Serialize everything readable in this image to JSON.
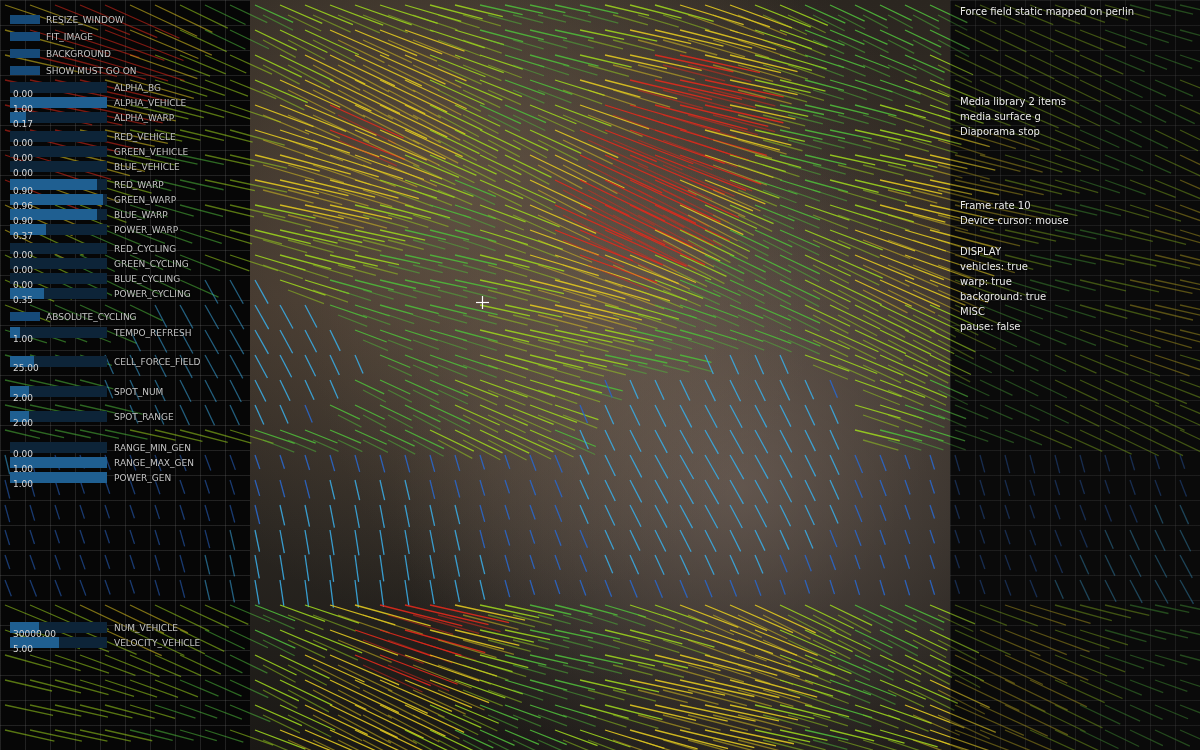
{
  "control_groups": [
    [
      {
        "kind": "button",
        "label": "RESIZE_WINDOW"
      },
      {
        "kind": "button",
        "label": "FIT_IMAGE"
      },
      {
        "kind": "button",
        "label": "BACKGROUND"
      },
      {
        "kind": "button",
        "label": "SHOW MUST GO ON"
      }
    ],
    [
      {
        "kind": "slider",
        "label": "ALPHA_BG",
        "value": "0.00",
        "level": 0.0
      },
      {
        "kind": "slider",
        "label": "ALPHA_VEHICLE",
        "value": "1.00",
        "level": 1.0
      },
      {
        "kind": "slider",
        "label": "ALPHA_WARP",
        "value": "0.17",
        "level": 0.17
      }
    ],
    [
      {
        "kind": "slider",
        "label": "RED_VEHICLE",
        "value": "0.00",
        "level": 0.0
      },
      {
        "kind": "slider",
        "label": "GREEN_VEHICLE",
        "value": "0.00",
        "level": 0.0
      },
      {
        "kind": "slider",
        "label": "BLUE_VEHICLE",
        "value": "0.00",
        "level": 0.0
      }
    ],
    [
      {
        "kind": "slider",
        "label": "RED_WARP",
        "value": "0.90",
        "level": 0.9
      },
      {
        "kind": "slider",
        "label": "GREEN_WARP",
        "value": "0.96",
        "level": 0.96
      },
      {
        "kind": "slider",
        "label": "BLUE_WARP",
        "value": "0.90",
        "level": 0.9
      },
      {
        "kind": "slider",
        "label": "POWER_WARP",
        "value": "0.37",
        "level": 0.37
      }
    ],
    [
      {
        "kind": "slider",
        "label": "RED_CYCLING",
        "value": "0.00",
        "level": 0.0
      },
      {
        "kind": "slider",
        "label": "GREEN_CYCLING",
        "value": "0.00",
        "level": 0.0
      },
      {
        "kind": "slider",
        "label": "BLUE_CYCLING",
        "value": "0.00",
        "level": 0.0
      },
      {
        "kind": "slider",
        "label": "POWER_CYCLING",
        "value": "0.35",
        "level": 0.35
      }
    ],
    [
      {
        "kind": "button",
        "label": "ABSOLUTE_CYCLING"
      },
      {
        "kind": "slider",
        "label": "TEMPO_REFRESH",
        "value": "1.00",
        "level": 0.1
      }
    ],
    [
      {
        "kind": "slider",
        "label": "CELL_FORCE_FIELD",
        "value": "25.00",
        "level": 0.25
      }
    ],
    [
      {
        "kind": "slider",
        "label": "SPOT_NUM",
        "value": "2.00",
        "level": 0.2
      }
    ],
    [
      {
        "kind": "slider",
        "label": "SPOT_RANGE",
        "value": "2.00",
        "level": 0.2
      }
    ],
    [
      {
        "kind": "slider",
        "label": "RANGE_MIN_GEN",
        "value": "0.00",
        "level": 0.0
      },
      {
        "kind": "slider",
        "label": "RANGE_MAX_GEN",
        "value": "1.00",
        "level": 1.0
      },
      {
        "kind": "slider",
        "label": "POWER_GEN",
        "value": "1.00",
        "level": 1.0
      }
    ],
    [
      {
        "kind": "slider",
        "label": "NUM_VEHICLE",
        "value": "30000.00",
        "level": 0.3
      },
      {
        "kind": "slider",
        "label": "VELOCITY_VEHICLE",
        "value": "5.00",
        "level": 0.5
      }
    ]
  ],
  "info_groups": [
    [
      "Force field static mapped on perlin"
    ],
    [
      "Media library 2 items",
      "media surface g",
      "Diaporama stop"
    ],
    [
      "Frame rate 10",
      "Device cursor: mouse"
    ],
    [
      "DISPLAY",
      "vehicles: true",
      "warp: true",
      "background: true",
      "MISC",
      "pause: false"
    ]
  ]
}
